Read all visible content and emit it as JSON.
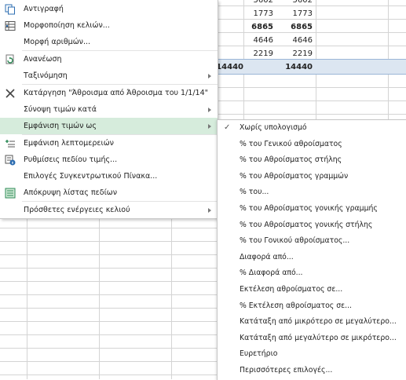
{
  "spreadsheet": {
    "rows": [
      {
        "c1": "5602",
        "c2": "5602",
        "bold": false
      },
      {
        "c1": "1773",
        "c2": "1773",
        "bold": false
      },
      {
        "c1": "6865",
        "c2": "6865",
        "bold": true
      },
      {
        "c1": "4646",
        "c2": "4646",
        "bold": false
      },
      {
        "c1": "2219",
        "c2": "2219",
        "bold": false
      },
      {
        "c1": "14440",
        "c2": "14440",
        "bold": true
      }
    ]
  },
  "context_menu": {
    "items": [
      {
        "label": "Αντιγραφή",
        "icon": "copy-icon",
        "submenu": false
      },
      {
        "label": "Μορφοποίηση κελιών...",
        "icon": "format-cells-icon",
        "submenu": false
      },
      {
        "label": "Μορφή αριθμών...",
        "icon": "",
        "submenu": false
      },
      {
        "label": "Ανανέωση",
        "icon": "refresh-icon",
        "submenu": false
      },
      {
        "label": "Ταξινόμηση",
        "icon": "",
        "submenu": true
      },
      {
        "label": "Κατάργηση \"Άθροισμα από Άθροισμα του 1/1/14\"",
        "icon": "remove-x-icon",
        "submenu": false
      },
      {
        "label": "Σύνοψη τιμών κατά",
        "icon": "",
        "submenu": true
      },
      {
        "label": "Εμφάνιση τιμών ως",
        "icon": "",
        "submenu": true,
        "highlighted": true
      },
      {
        "label": "Εμφάνιση λεπτομερειών",
        "icon": "expand-details-icon",
        "submenu": false
      },
      {
        "label": "Ρυθμίσεις πεδίου τιμής...",
        "icon": "field-settings-icon",
        "submenu": false
      },
      {
        "label": "Επιλογές Συγκεντρωτικού Πίνακα...",
        "icon": "",
        "submenu": false
      },
      {
        "label": "Απόκρυψη λίστας πεδίων",
        "icon": "field-list-icon",
        "submenu": false
      },
      {
        "label": "Πρόσθετες ενέργειες κελιού",
        "icon": "",
        "submenu": true
      }
    ]
  },
  "submenu": {
    "items": [
      {
        "label": "Χωρίς υπολογισμό",
        "checked": true
      },
      {
        "label": "% του Γενικού αθροίσματος",
        "checked": false
      },
      {
        "label": "% του Αθροίσματος στήλης",
        "checked": false
      },
      {
        "label": "% του Αθροίσματος γραμμών",
        "checked": false
      },
      {
        "label": "% του...",
        "checked": false
      },
      {
        "label": "% του Αθροίσματος γονικής γραμμής",
        "checked": false
      },
      {
        "label": "% του Αθροίσματος γονικής στήλης",
        "checked": false
      },
      {
        "label": "% του Γονικού αθροίσματος...",
        "checked": false
      },
      {
        "label": "Διαφορά από...",
        "checked": false
      },
      {
        "label": "% Διαφορά από...",
        "checked": false
      },
      {
        "label": "Εκτέλεση αθροίσματος σε...",
        "checked": false
      },
      {
        "label": "% Εκτέλεση αθροίσματος σε...",
        "checked": false
      },
      {
        "label": "Κατάταξη από μικρότερο σε μεγαλύτερο...",
        "checked": false
      },
      {
        "label": "Κατάταξη από μεγαλύτερο σε μικρότερο...",
        "checked": false
      },
      {
        "label": "Ευρετήριο",
        "checked": false
      },
      {
        "label": "Περισσότερες επιλογές...",
        "checked": false
      }
    ],
    "check_mark": "✓"
  },
  "colors": {
    "highlight": "#d6ecdc",
    "total_band": "#dce6f1",
    "icon_green": "#2e8b57",
    "icon_blue": "#2b6cb0"
  }
}
